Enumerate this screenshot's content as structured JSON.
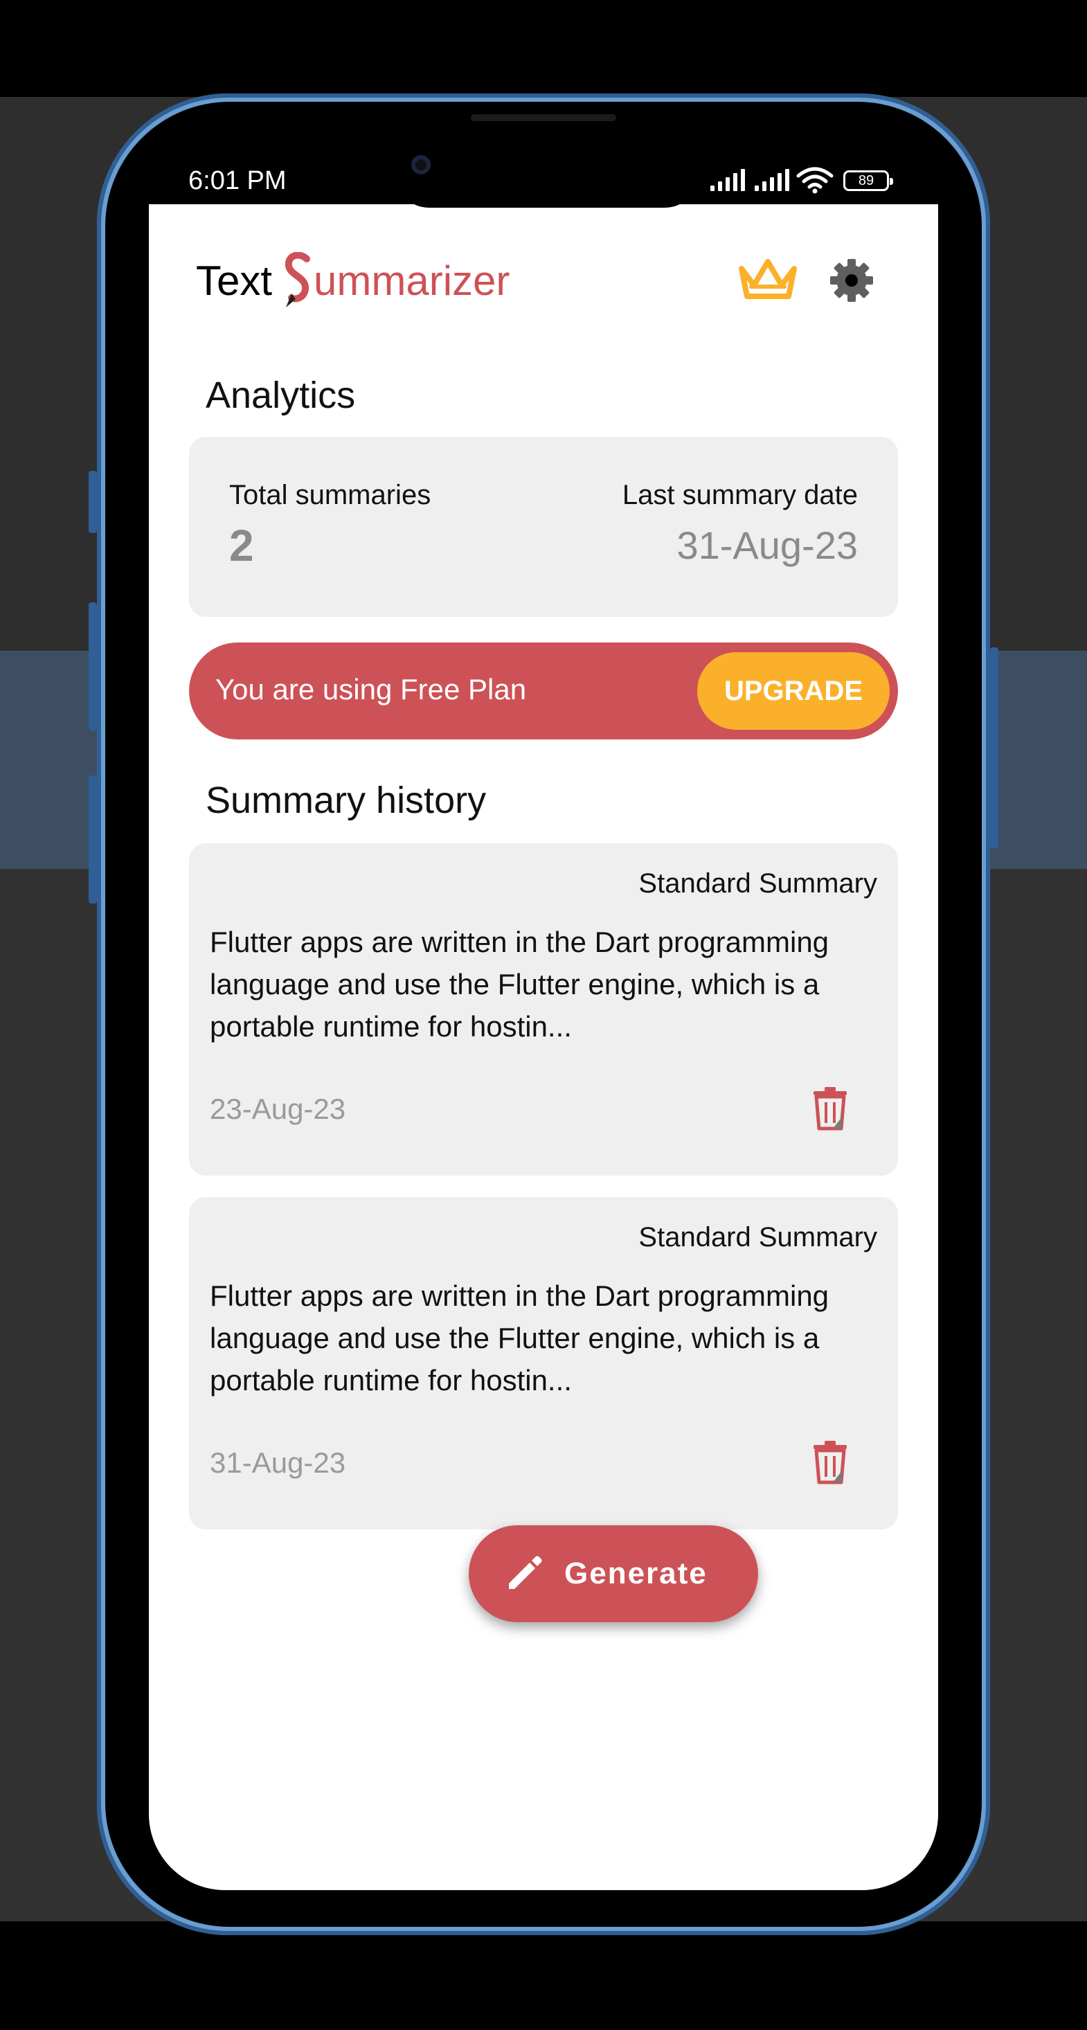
{
  "status_bar": {
    "time": "6:01 PM",
    "battery": "89",
    "icons": [
      "signal-icon",
      "signal-icon",
      "wifi-icon",
      "battery-icon"
    ]
  },
  "header": {
    "logo_word1": "Text",
    "logo_word2": "ummarizer",
    "logo_icon": "pen-s-logo",
    "actions": [
      "crown-icon",
      "gear-icon"
    ]
  },
  "analytics": {
    "title": "Analytics",
    "total_label": "Total summaries",
    "total_value": "2",
    "last_label": "Last summary date",
    "last_value": "31-Aug-23"
  },
  "plan": {
    "text": "You are using Free Plan",
    "upgrade_label": "UPGRADE"
  },
  "history": {
    "title": "Summary history",
    "items": [
      {
        "type": "Standard Summary",
        "text": "Flutter apps are written in the Dart programming language and use the Flutter engine, which is a portable runtime for hostin...",
        "date": "23-Aug-23"
      },
      {
        "type": "Standard Summary",
        "text": "Flutter apps are written in the Dart programming language and use the Flutter engine, which is a portable runtime for hostin...",
        "date": "31-Aug-23"
      }
    ]
  },
  "fab": {
    "label": "Generate",
    "icon": "pencil-icon"
  },
  "colors": {
    "brand_red": "#cd5257",
    "upgrade_orange": "#fbb02b",
    "card_gray": "#efefef",
    "muted_text": "#8a8a8a",
    "phone_frame_blue": "#4a7fb5"
  }
}
